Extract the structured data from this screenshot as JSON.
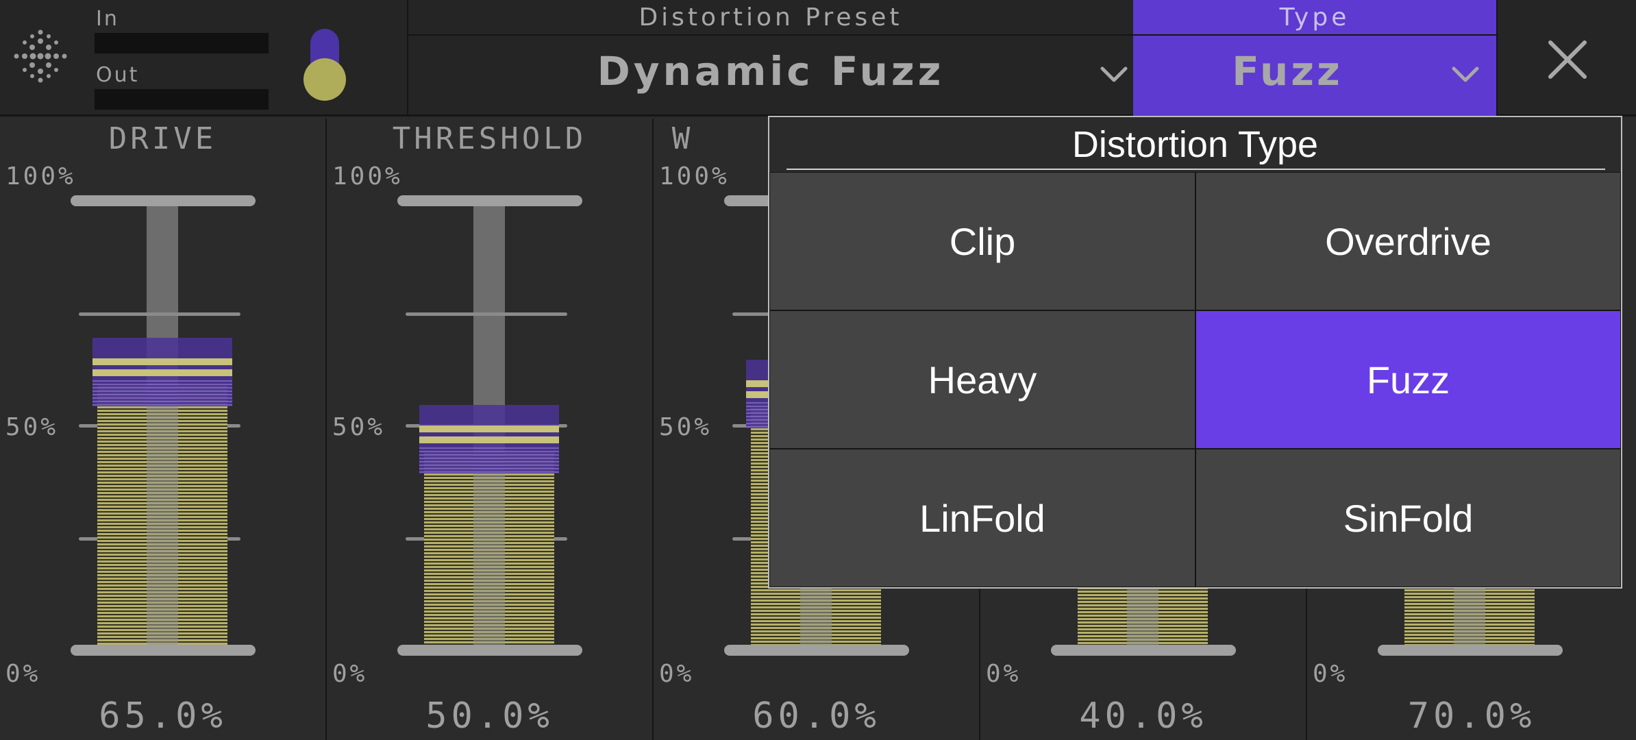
{
  "header": {
    "in_label": "In",
    "out_label": "Out",
    "preset": {
      "label": "Distortion Preset",
      "value": "Dynamic Fuzz"
    },
    "type": {
      "label": "Type",
      "value": "Fuzz"
    },
    "close_icon": "close-icon",
    "logo_icon": "dot-grid-logo-icon",
    "toggle_on": true
  },
  "axis": {
    "max": "100%",
    "mid": "50%",
    "min": "0%"
  },
  "sliders": [
    {
      "name": "DRIVE",
      "value": "65.0%",
      "level": 65
    },
    {
      "name": "THRESHOLD",
      "value": "50.0%",
      "level": 50
    },
    {
      "name": "W",
      "value": "60.0%",
      "level": 60
    },
    {
      "name": "",
      "value": "40.0%",
      "level": 40
    },
    {
      "name": "",
      "value": "70.0%",
      "level": 70
    }
  ],
  "popup": {
    "title": "Distortion Type",
    "options": [
      "Clip",
      "Overdrive",
      "Heavy",
      "Fuzz",
      "LinFold",
      "SinFold"
    ],
    "selected": "Fuzz"
  },
  "colors": {
    "accent": "#6a3ee6",
    "type_bg": "#5e3ad0",
    "fill": "#b6b06a"
  }
}
